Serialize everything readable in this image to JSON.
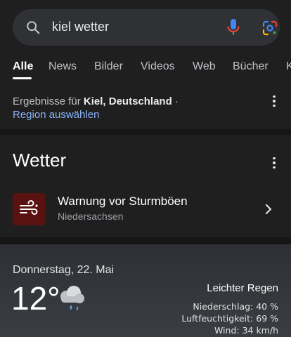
{
  "search": {
    "query": "kiel wetter",
    "icons": {
      "left": "search-icon",
      "voice": "mic-icon",
      "lens": "google-lens-icon"
    }
  },
  "tabs": [
    {
      "label": "Alle",
      "active": true
    },
    {
      "label": "News"
    },
    {
      "label": "Bilder"
    },
    {
      "label": "Videos"
    },
    {
      "label": "Web"
    },
    {
      "label": "Bücher"
    },
    {
      "label": "K"
    }
  ],
  "location_notice": {
    "prefix": "Ergebnisse für ",
    "place": "Kiel, Deutschland",
    "suffix": " ·",
    "region_link": "Region auswählen"
  },
  "weather": {
    "section_title": "Wetter",
    "warning": {
      "title": "Warnung vor Sturmböen",
      "region": "Niedersachsen",
      "icon": "wind-warning-icon",
      "color": "#5a1210"
    },
    "date": "Donnerstag, 22. Mai",
    "temperature": "12°",
    "condition": "Leichter Regen",
    "precipitation": "Niederschlag: 40 %",
    "humidity": "Luftfeuchtigkeit: 69 %",
    "wind": "Wind: 34 km/h"
  },
  "colors": {
    "background": "#1f1f1f",
    "search_bg": "#303134",
    "link": "#8ab4f8",
    "mic_blue": "#4285f4",
    "mic_red": "#ea4335"
  }
}
